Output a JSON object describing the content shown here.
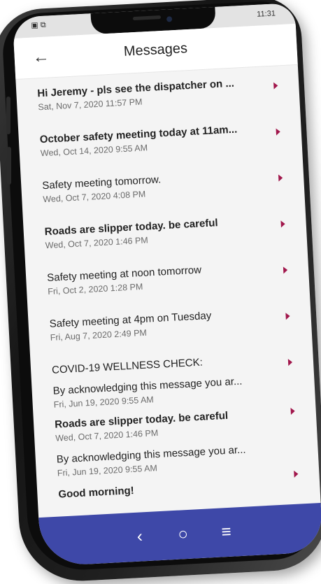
{
  "status": {
    "left_icons": "▣ ⧉",
    "time": "11:31"
  },
  "header": {
    "back_icon": "←",
    "title": "Messages"
  },
  "messages": [
    {
      "title": "Hi Jeremy - pls see the dispatcher on ...",
      "date": "Sat, Nov 7, 2020 11:57 PM",
      "bold": true
    },
    {
      "title": "October safety meeting today at 11am...",
      "date": "Wed, Oct 14, 2020 9:55 AM",
      "bold": true
    },
    {
      "title": "Safety meeting tomorrow.",
      "date": "Wed, Oct 7, 2020 4:08 PM",
      "bold": false
    },
    {
      "title": "Roads are slipper today. be careful",
      "date": "Wed, Oct 7, 2020 1:46 PM",
      "bold": true
    },
    {
      "title": "Safety meeting at noon  tomorrow",
      "date": "Fri, Oct 2, 2020 1:28 PM",
      "bold": false
    },
    {
      "title": "Safety meeting at 4pm on Tuesday",
      "date": "Fri, Aug 7, 2020 2:49 PM",
      "bold": false
    },
    {
      "title": "COVID-19 WELLNESS CHECK:",
      "date": "",
      "bold": false
    },
    {
      "title": "By acknowledging this message you ar...",
      "date": "Fri, Jun 19, 2020 9:55 AM",
      "bold": false
    },
    {
      "title": "Roads are slipper today. be careful",
      "date": "Wed, Oct 7, 2020 1:46 PM",
      "bold": true
    },
    {
      "title": "By acknowledging this message you ar...",
      "date": "Fri, Jun 19, 2020 9:55 AM",
      "bold": false
    },
    {
      "title": "Good morning!",
      "date": "",
      "bold": true
    }
  ],
  "navbar": {
    "back": "‹",
    "home": "○",
    "menu": "≡",
    "color": "#3e48a8"
  },
  "colors": {
    "accent": "#a1164b"
  }
}
